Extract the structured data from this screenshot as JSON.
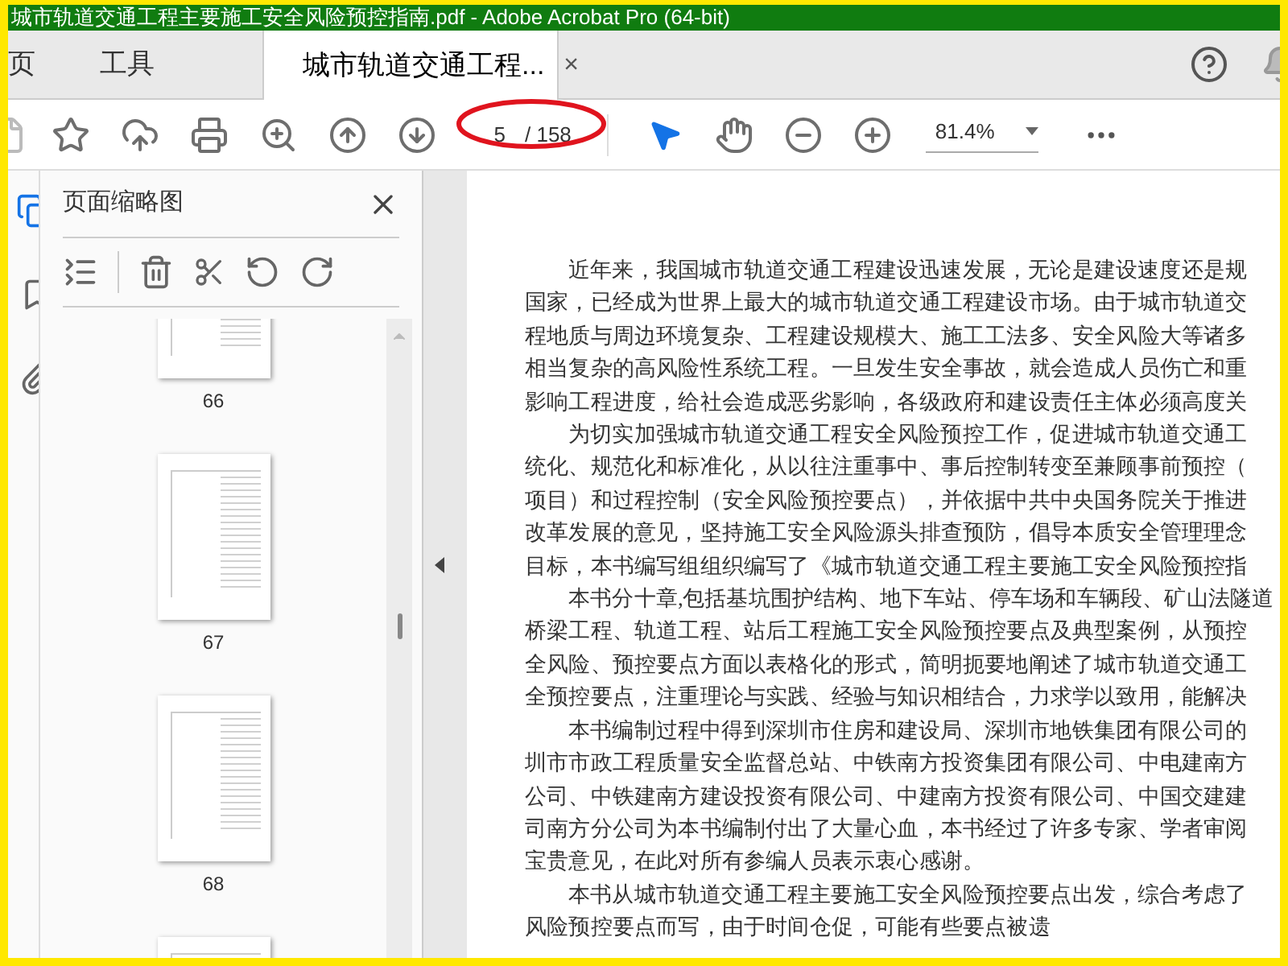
{
  "window": {
    "title": "城市轨道交通工程主要施工安全风险预控指南.pdf - Adobe Acrobat Pro (64-bit)"
  },
  "tabs": [
    {
      "label": "页",
      "selected": false
    },
    {
      "label": "工具",
      "selected": false
    },
    {
      "label": "城市轨道交通工程...",
      "selected": true,
      "close": "×"
    }
  ],
  "toolbar": {
    "page": "5",
    "page_total": "/ 158",
    "zoom": "81.4%",
    "tools": [
      {
        "selected": true
      },
      {
        "selected": false
      }
    ]
  },
  "sidebar": {
    "title": "页面缩略图",
    "thumbnails": [
      {
        "label": "66"
      },
      {
        "label": "67"
      },
      {
        "label": "68"
      }
    ]
  },
  "document": {
    "paragraphs": [
      [
        "近年来，我国城市轨道交通工程建设迅速发展，无论是建设速度还是规",
        "国家，已经成为世界上最大的城市轨道交通工程建设市场。由于城市轨道交",
        "程地质与周边环境复杂、工程建设规模大、施工工法多、安全风险大等诸多",
        "相当复杂的高风险性系统工程。一旦发生安全事故，就会造成人员伤亡和重",
        "影响工程进度，给社会造成恶劣影响，各级政府和建设责任主体必须高度关"
      ],
      [
        "为切实加强城市轨道交通工程安全风险预控工作，促进城市轨道交通工",
        "统化、规范化和标准化，从以往注重事中、事后控制转变至兼顾事前预控（",
        "项目）和过程控制（安全风险预控要点），并依据中共中央国务院关于推进",
        "改革发展的意见，坚持施工安全风险源头排查预防，倡导本质安全管理理念",
        "目标，本书编写组组织编写了《城市轨道交通工程主要施工安全风险预控指"
      ],
      [
        "本书分十章,包括基坑围护结构、地下车站、停车场和车辆段、矿山法隧道",
        "桥梁工程、轨道工程、站后工程施工安全风险预控要点及典型案例，从预控",
        "全风险、预控要点方面以表格化的形式，简明扼要地阐述了城市轨道交通工",
        "全预控要点，注重理论与实践、经验与知识相结合，力求学以致用，能解决"
      ],
      [
        "本书编制过程中得到深圳市住房和建设局、深圳市地铁集团有限公司的",
        "圳市市政工程质量安全监督总站、中铁南方投资集团有限公司、中电建南方",
        "公司、中铁建南方建设投资有限公司、中建南方投资有限公司、中国交建建",
        "司南方分公司为本书编制付出了大量心血，本书经过了许多专家、学者审阅",
        "宝贵意见，在此对所有参编人员表示衷心感谢。"
      ],
      [
        "本书从城市轨道交通工程主要施工安全风险预控要点出发，综合考虑了",
        "风险预控要点而写，由于时间仓促，可能有些要点被遗"
      ]
    ]
  }
}
